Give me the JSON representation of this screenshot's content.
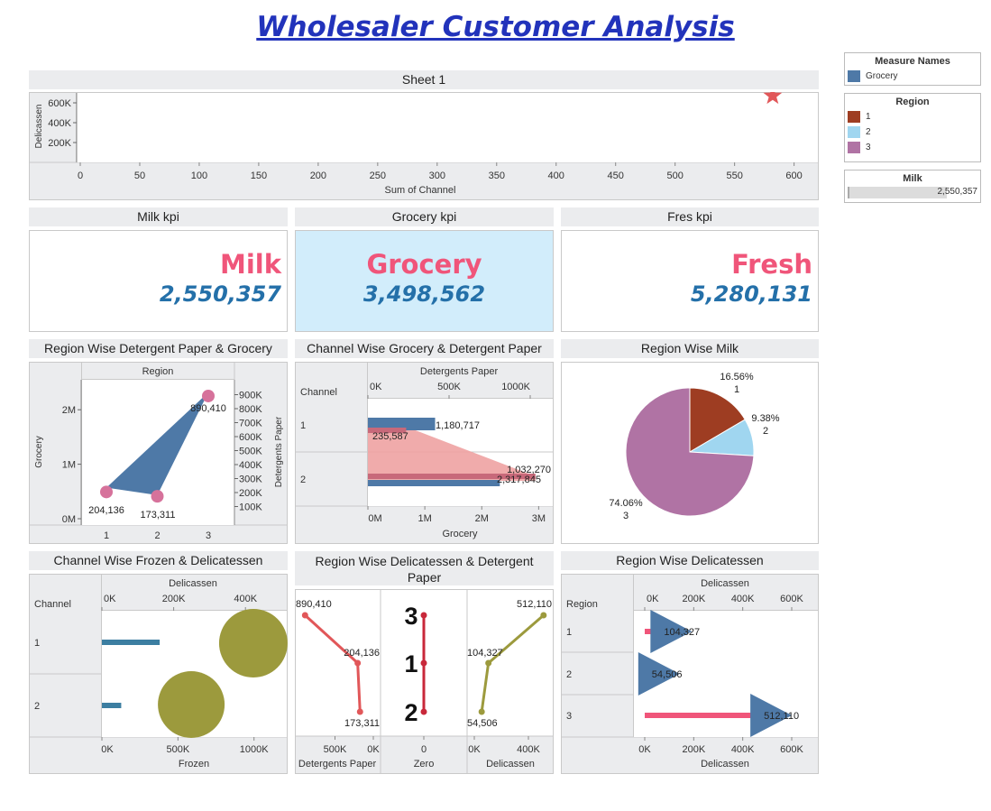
{
  "page": {
    "title": "Wholesaler Customer Analysis"
  },
  "colors": {
    "title": "#2233bb",
    "grocery": "#4e79a7",
    "region1": "#9e3d22",
    "region2": "#a0d6f0",
    "region3": "#b073a4",
    "kpi_name": "#f0557a",
    "kpi_value": "#2470a9",
    "star": "#e15759",
    "olive": "#9c9a3d",
    "teal": "#3c7ea1",
    "pink": "#f0557a"
  },
  "legends": {
    "measure": {
      "title": "Measure Names",
      "items": [
        {
          "label": "Grocery",
          "color": "#4e79a7"
        }
      ]
    },
    "region": {
      "title": "Region",
      "items": [
        {
          "label": "1",
          "color": "#9e3d22"
        },
        {
          "label": "2",
          "color": "#a0d6f0"
        },
        {
          "label": "3",
          "color": "#b073a4"
        }
      ]
    },
    "milk": {
      "title": "Milk",
      "value_label": "2,550,357",
      "fill_fraction": 0.75
    }
  },
  "kpis": [
    {
      "header": "Milk kpi",
      "name": "Milk",
      "value": "2,550,357"
    },
    {
      "header": "Grocery kpi",
      "name": "Grocery",
      "value": "3,498,562"
    },
    {
      "header": "Fres kpi",
      "name": "Fresh",
      "value": "5,280,131"
    }
  ],
  "chart_data": [
    {
      "id": "sheet1",
      "type": "scatter",
      "title": "Sheet 1",
      "xlabel": "Sum of Channel",
      "ylabel": "Delicassen",
      "xlim": [
        0,
        620
      ],
      "ylim": [
        0,
        700000
      ],
      "x_ticks": [
        "0",
        "50",
        "100",
        "150",
        "200",
        "250",
        "300",
        "350",
        "400",
        "450",
        "500",
        "550",
        "600"
      ],
      "y_ticks": [
        "200K",
        "400K",
        "600K"
      ],
      "points": [
        {
          "x": 582,
          "y": 670943,
          "marker": "star"
        }
      ]
    },
    {
      "id": "region-det-grocery",
      "type": "area",
      "title": "Region Wise Detergent Paper & Grocery",
      "header": "Region",
      "xlabel": "",
      "ylabel": "Grocery",
      "y2label": "Detergents Paper",
      "categories": [
        "1",
        "2",
        "3"
      ],
      "y_ticks": [
        "0M",
        "1M",
        "2M"
      ],
      "ylim": [
        0,
        2500000
      ],
      "y2_ticks": [
        "100K",
        "200K",
        "300K",
        "400K",
        "500K",
        "600K",
        "700K",
        "800K",
        "900K"
      ],
      "y2lim": [
        0,
        1000000
      ],
      "grocery": [
        570000,
        433000,
        2317845
      ],
      "detergents_paper": [
        204136,
        173311,
        890410
      ],
      "labels": [
        "204,136",
        "173,311",
        "890,410"
      ]
    },
    {
      "id": "channel-grocery-det",
      "type": "bar",
      "title": "Channel Wise Grocery & Detergent Paper",
      "header": "Detergents Paper",
      "row_header": "Channel",
      "xlabel": "Grocery",
      "categories": [
        "1",
        "2"
      ],
      "top_ticks": [
        "0K",
        "500K",
        "1000K"
      ],
      "top_lim": [
        0,
        1050000
      ],
      "bottom_ticks": [
        "0M",
        "1M",
        "2M",
        "3M"
      ],
      "bottom_lim": [
        0,
        3200000
      ],
      "grocery": [
        1180717,
        2317845
      ],
      "detergents_paper": [
        235587,
        1032270
      ],
      "grocery_labels": [
        "1,180,717",
        "2,317,845"
      ],
      "detergents_labels": [
        "235,587",
        "1,032,270"
      ]
    },
    {
      "id": "region-milk",
      "type": "pie",
      "title": "Region Wise Milk",
      "slices": [
        {
          "region": "1",
          "percent": 16.56,
          "label": "16.56%",
          "sub": "1"
        },
        {
          "region": "2",
          "percent": 9.38,
          "label": "9.38%",
          "sub": "2"
        },
        {
          "region": "3",
          "percent": 74.06,
          "label": "74.06%",
          "sub": "3"
        }
      ]
    },
    {
      "id": "channel-frozen-deli",
      "type": "bar",
      "title": "Channel Wise Frozen & Delicatessen",
      "header": "Delicassen",
      "row_header": "Channel",
      "xlabel": "Frozen",
      "categories": [
        "1",
        "2"
      ],
      "top_ticks": [
        "0K",
        "200K",
        "400K"
      ],
      "top_lim": [
        0,
        500000
      ],
      "bottom_ticks": [
        "0K",
        "500K",
        "1000K"
      ],
      "bottom_lim": [
        0,
        1150000
      ],
      "frozen": [
        380000,
        127000
      ],
      "delicassen": [
        421955,
        248988
      ]
    },
    {
      "id": "region-deli-det",
      "type": "line",
      "title": "Region Wise Delicatessen & Detergent Paper",
      "regions": [
        "3",
        "1",
        "2"
      ],
      "detergents_paper": [
        890410,
        204136,
        173311
      ],
      "detergents_labels": [
        "890,410",
        "204,136",
        "173,311"
      ],
      "delicassen": [
        512110,
        104327,
        54506
      ],
      "delicassen_labels": [
        "512,110",
        "104,327",
        "54,506"
      ],
      "det_ticks": [
        "500K",
        "0K"
      ],
      "zero_ticks": [
        "0"
      ],
      "deli_ticks": [
        "0K",
        "400K"
      ],
      "xlabels": [
        "Detergents Paper",
        "Zero",
        "Delicassen"
      ]
    },
    {
      "id": "region-deli",
      "type": "bar",
      "title": "Region Wise Delicatessen",
      "header": "Delicassen",
      "row_header": "Region",
      "xlabel": "Delicassen",
      "categories": [
        "1",
        "2",
        "3"
      ],
      "values": [
        104327,
        54506,
        512110
      ],
      "labels": [
        "104,327",
        "54,506",
        "512,110"
      ],
      "ticks": [
        "0K",
        "200K",
        "400K",
        "600K"
      ],
      "xlim": [
        0,
        700000
      ]
    }
  ]
}
